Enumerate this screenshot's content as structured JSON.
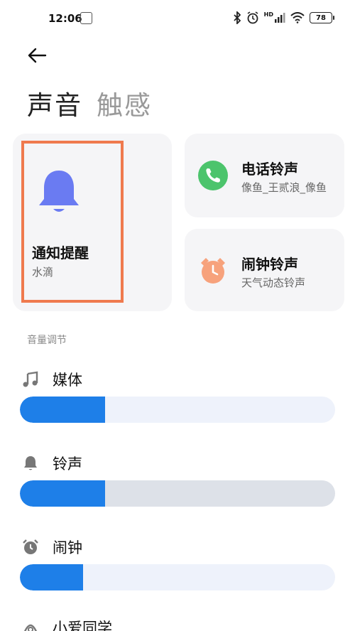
{
  "status_bar": {
    "time": "12:06",
    "network_label": "HD",
    "battery": "78"
  },
  "tabs": [
    {
      "label": "声音",
      "active": true
    },
    {
      "label": "触感",
      "active": false
    }
  ],
  "cards": {
    "notification": {
      "title": "通知提醒",
      "subtitle": "水滴",
      "icon": "bell-icon",
      "color": "#6a7bf2"
    },
    "ringtone": {
      "title": "电话铃声",
      "subtitle": "像鱼_王贰浪_像鱼",
      "icon": "phone-icon",
      "color": "#4cc46c"
    },
    "alarm": {
      "title": "闹钟铃声",
      "subtitle": "天气动态铃声",
      "icon": "alarm-clock-icon",
      "color": "#f7a27c"
    }
  },
  "volume": {
    "section_label": "音量调节",
    "rows": [
      {
        "label": "媒体",
        "icon": "music-note-icon",
        "level": 0.27,
        "track_color": "#eef2fb"
      },
      {
        "label": "铃声",
        "icon": "bell-icon",
        "level": 0.27,
        "track_color": "#dde1e8"
      },
      {
        "label": "闹钟",
        "icon": "alarm-clock-icon",
        "level": 0.2,
        "track_color": "#eef2fb"
      },
      {
        "label": "小爱同学",
        "icon": "assistant-icon",
        "level": null,
        "track_color": "#eef2fb"
      }
    ]
  },
  "colors": {
    "accent": "#1e7fe8",
    "highlight_border": "#ef7a4e"
  }
}
